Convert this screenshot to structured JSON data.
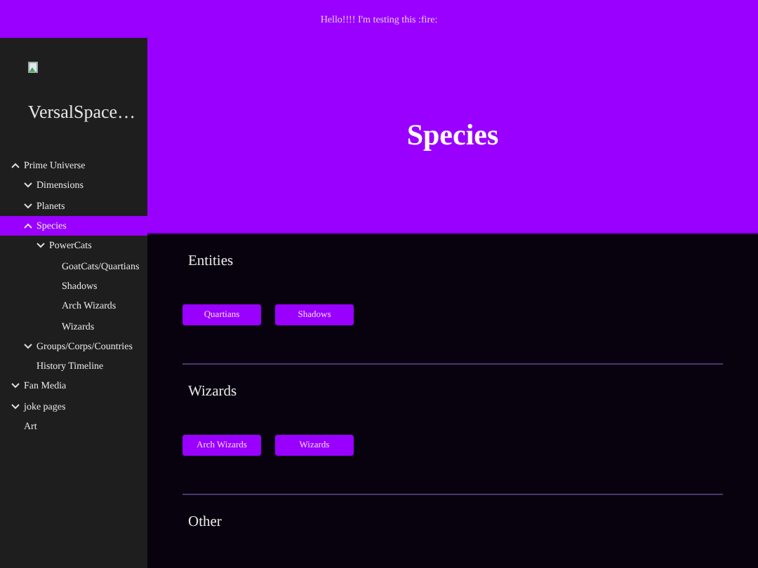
{
  "banner": {
    "text": "Hello!!!! I'm testing this :fire:"
  },
  "sidebar": {
    "title": "VersalSpace…",
    "items": [
      {
        "label": "Prime Universe",
        "kind": "group",
        "expanded": true,
        "selected": false,
        "children": [
          {
            "label": "Dimensions",
            "kind": "group",
            "expanded": false,
            "selected": false
          },
          {
            "label": "Planets",
            "kind": "group",
            "expanded": false,
            "selected": false
          },
          {
            "label": "Species",
            "kind": "group",
            "expanded": true,
            "selected": true,
            "children": [
              {
                "label": "PowerCats",
                "kind": "group",
                "expanded": false,
                "selected": false,
                "children": [
                  {
                    "label": "GoatCats/Quartians",
                    "kind": "page",
                    "selected": false
                  },
                  {
                    "label": "Shadows",
                    "kind": "page",
                    "selected": false
                  },
                  {
                    "label": "Arch Wizards",
                    "kind": "page",
                    "selected": false
                  },
                  {
                    "label": "Wizards",
                    "kind": "page",
                    "selected": false
                  }
                ]
              }
            ]
          },
          {
            "label": "Groups/Corps/Countries",
            "kind": "group",
            "expanded": false,
            "selected": false
          },
          {
            "label": "History Timeline",
            "kind": "page",
            "selected": false
          }
        ]
      },
      {
        "label": "Fan Media",
        "kind": "group",
        "expanded": false,
        "selected": false
      },
      {
        "label": "joke pages",
        "kind": "group",
        "expanded": false,
        "selected": false
      },
      {
        "label": "Art",
        "kind": "page",
        "selected": false
      }
    ]
  },
  "hero": {
    "title": "Species"
  },
  "sections": [
    {
      "heading": "Entities",
      "buttons": [
        "Quartians",
        "Shadows"
      ]
    },
    {
      "heading": "Wizards",
      "buttons": [
        "Arch Wizards",
        "Wizards"
      ]
    },
    {
      "heading": "Other"
    }
  ]
}
